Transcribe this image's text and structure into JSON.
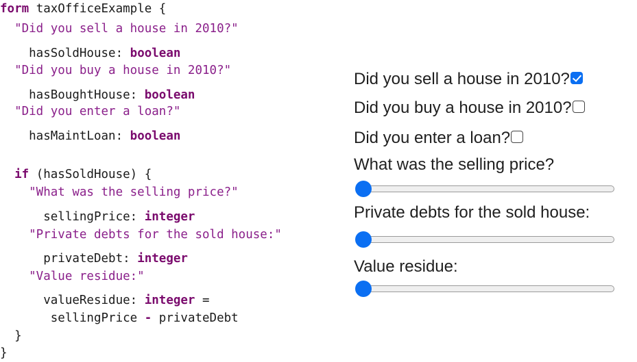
{
  "code": {
    "lines": [
      [
        {
          "t": "form",
          "c": "kw"
        },
        {
          "t": " taxOfficeExample {",
          "c": "plain"
        }
      ],
      [
        {
          "t": "  \"Did you sell a house in 2010?\"",
          "c": "str"
        }
      ],
      [
        {
          "t": "    hasSoldHouse: ",
          "c": "plain"
        },
        {
          "t": "boolean",
          "c": "kw"
        }
      ],
      [
        {
          "t": "  \"Did you buy a house in 2010?\"",
          "c": "str"
        }
      ],
      [
        {
          "t": "    hasBoughtHouse: ",
          "c": "plain"
        },
        {
          "t": "boolean",
          "c": "kw"
        }
      ],
      [
        {
          "t": "  \"Did you enter a loan?\"",
          "c": "str"
        }
      ],
      [
        {
          "t": "    hasMaintLoan: ",
          "c": "plain"
        },
        {
          "t": "boolean",
          "c": "kw"
        }
      ],
      [
        {
          "t": "  ",
          "c": "plain"
        },
        {
          "t": "if",
          "c": "kw"
        },
        {
          "t": " (hasSoldHouse) {",
          "c": "plain"
        }
      ],
      [
        {
          "t": "    \"What was the selling price?\"",
          "c": "str"
        }
      ],
      [
        {
          "t": "      sellingPrice: ",
          "c": "plain"
        },
        {
          "t": "integer",
          "c": "kw"
        }
      ],
      [
        {
          "t": "    \"Private debts for the sold house:\"",
          "c": "str"
        }
      ],
      [
        {
          "t": "      privateDebt: ",
          "c": "plain"
        },
        {
          "t": "integer",
          "c": "kw"
        }
      ],
      [
        {
          "t": "    \"Value residue:\"",
          "c": "str"
        }
      ],
      [
        {
          "t": "      valueResidue: ",
          "c": "plain"
        },
        {
          "t": "integer",
          "c": "kw"
        },
        {
          "t": " =",
          "c": "plain"
        }
      ],
      [
        {
          "t": "       sellingPrice ",
          "c": "plain"
        },
        {
          "t": "-",
          "c": "kw"
        },
        {
          "t": " privateDebt",
          "c": "plain"
        }
      ],
      [
        {
          "t": "  }",
          "c": "plain"
        }
      ],
      [
        {
          "t": "}",
          "c": "plain"
        }
      ]
    ]
  },
  "form": {
    "questions": [
      {
        "label": "Did you sell a house in 2010?",
        "checked": true
      },
      {
        "label": "Did you buy a house in 2010?",
        "checked": false
      },
      {
        "label": "Did you enter a loan?",
        "checked": false
      }
    ],
    "sliders": [
      {
        "label": "What was the selling price?",
        "value_fraction": 0
      },
      {
        "label": "Private debts for the sold house:",
        "value_fraction": 0
      },
      {
        "label": "Value residue:",
        "value_fraction": 0
      }
    ]
  },
  "colors": {
    "keyword": "#7a0a6d",
    "string": "#8a1f8a",
    "accent": "#0b6ff2"
  }
}
